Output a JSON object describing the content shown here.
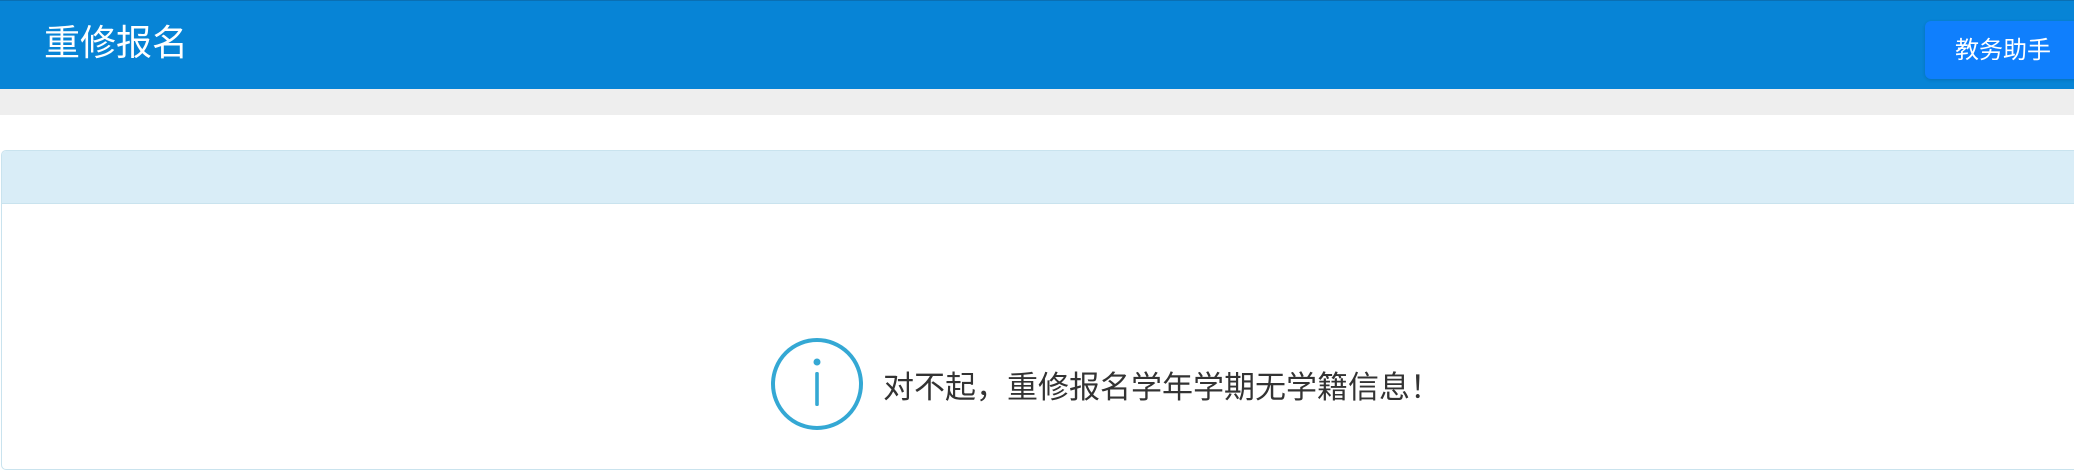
{
  "header": {
    "title": "重修报名",
    "helper_button_label": "教务助手"
  },
  "notice": {
    "icon": "info-circle-icon",
    "message": "对不起，重修报名学年学期无学籍信息！"
  },
  "colors": {
    "header_bg": "#0784d6",
    "helper_button_bg": "#0f7ffd",
    "panel_heading_bg": "#d9edf7",
    "info_icon": "#34a8d4"
  }
}
